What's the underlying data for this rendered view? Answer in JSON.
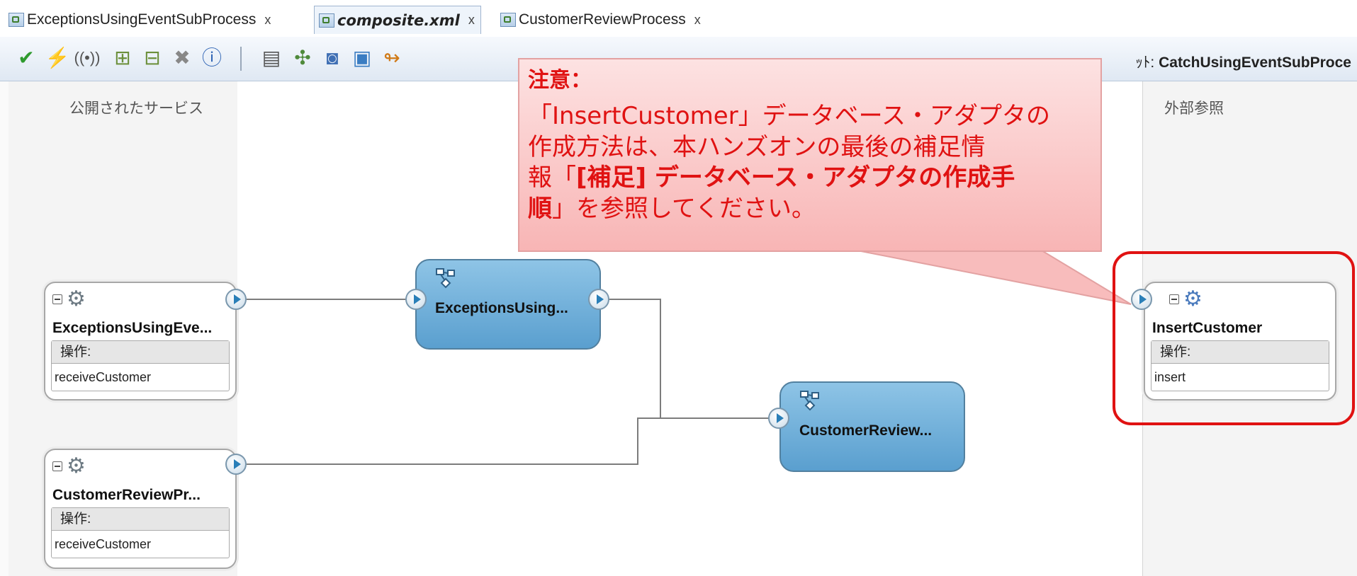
{
  "tabs": [
    {
      "label": "ExceptionsUsingEventSubProcess",
      "close": "x",
      "active": false
    },
    {
      "label": "composite.xml",
      "close": "x",
      "active": true
    },
    {
      "label": "CustomerReviewProcess",
      "close": "x",
      "active": false
    }
  ],
  "toolbar": {
    "icons": [
      "validate-icon",
      "deploy-icon",
      "wireless-icon",
      "add-icon",
      "remove-icon",
      "delete-icon",
      "info-icon",
      "database-icon",
      "component-icon",
      "refresh-icon",
      "upload-icon",
      "turn-icon"
    ],
    "target_prefix": "ｯﾄ:",
    "target_value": "CatchUsingEventSubProce"
  },
  "lanes": {
    "left_title": "公開されたサービス",
    "right_title": "外部参照"
  },
  "services": [
    {
      "name": "ExceptionsUsingEve...",
      "ops_label": "操作:",
      "operation": "receiveCustomer"
    },
    {
      "name": "CustomerReviewPr...",
      "ops_label": "操作:",
      "operation": "receiveCustomer"
    }
  ],
  "components": [
    {
      "name": "ExceptionsUsing..."
    },
    {
      "name": "CustomerReview..."
    }
  ],
  "reference": {
    "name": "InsertCustomer",
    "ops_label": "操作:",
    "operation": "insert"
  },
  "callout": {
    "title": "注意：",
    "line1": "「InsertCustomer」データベース・アダプタの",
    "line2": "作成方法は、本ハンズオンの最後の補足情",
    "line3_prefix": "報「",
    "line3_bold": "[補足] データベース・アダプタの作成手",
    "line4_bold": "順",
    "line4_rest": "」を参照してください。"
  },
  "colors": {
    "callout_text": "#e01212",
    "component_fill": "#6fb0db",
    "highlight": "#e01212"
  }
}
